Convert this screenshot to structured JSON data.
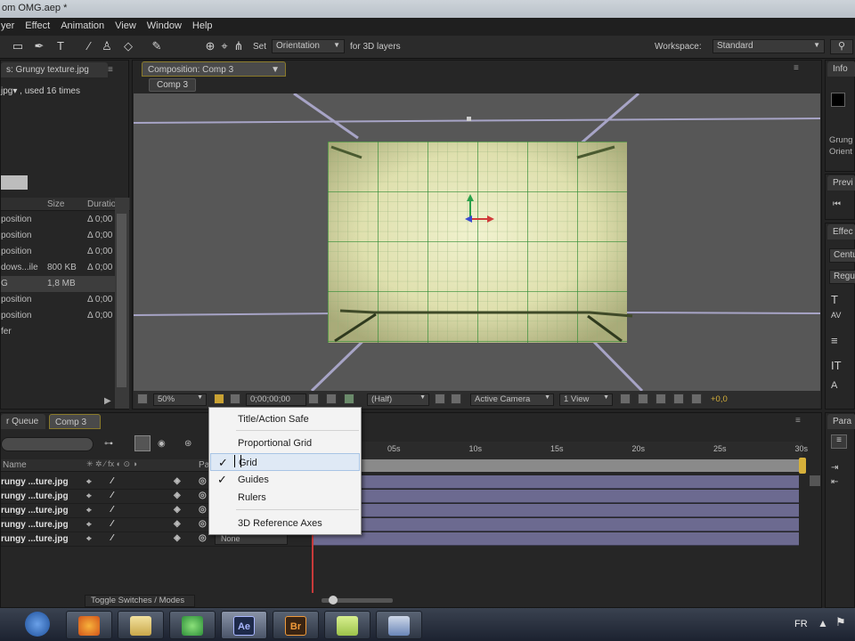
{
  "window": {
    "title": "om OMG.aep *"
  },
  "menubar": [
    "yer",
    "Effect",
    "Animation",
    "View",
    "Window",
    "Help"
  ],
  "toolbar": {
    "set_label": "Set",
    "orientation_value": "Orientation",
    "for_label": "for 3D layers",
    "workspace_label": "Workspace:",
    "workspace_value": "Standard"
  },
  "project": {
    "tab_label": "s: Grungy texture.jpg",
    "file_label": "jpg▾ , used 16 times",
    "col_size": "Size",
    "col_duration": "Duration",
    "rows": [
      {
        "name": "position",
        "size": "",
        "duration": "Δ 0;00"
      },
      {
        "name": "position",
        "size": "",
        "duration": "Δ 0;00"
      },
      {
        "name": "position",
        "size": "",
        "duration": "Δ 0;00"
      },
      {
        "name": "dows...ile",
        "size": "800 KB",
        "duration": "Δ 0;00"
      },
      {
        "name": "G",
        "size": "1,8 MB",
        "duration": ""
      },
      {
        "name": "position",
        "size": "",
        "duration": "Δ 0;00"
      },
      {
        "name": "position",
        "size": "",
        "duration": "Δ 0;00"
      },
      {
        "name": "fer",
        "size": "",
        "duration": ""
      }
    ]
  },
  "composition": {
    "tab_label": "Composition: Comp 3",
    "comp_button": "Comp 3",
    "zoom": "50%",
    "timecode": "0;00;00;00",
    "resolution": "(Half)",
    "camera": "Active Camera",
    "views": "1 View",
    "exposure": "+0,0"
  },
  "right": {
    "info_tab": "Info",
    "info_lines": [
      "Grung",
      "Orient"
    ],
    "preview_tab": "Previ",
    "effects_tab": "Effec",
    "effects_dd1": "Centu",
    "effects_dd2": "Regul",
    "para_tab": "Para"
  },
  "timeline": {
    "tab_queue": "r Queue",
    "tab_comp": "Comp 3",
    "col_name": "Name",
    "col_parent": "Pa",
    "ruler": [
      "05s",
      "10s",
      "15s",
      "20s",
      "25s",
      "30s"
    ],
    "layers": [
      "rungy ...ture.jpg",
      "rungy ...ture.jpg",
      "rungy ...ture.jpg",
      "rungy ...ture.jpg",
      "rungy ...ture.jpg"
    ],
    "parent_value": "None",
    "toggle_label": "Toggle Switches / Modes"
  },
  "menu": {
    "items": [
      {
        "label": "Title/Action Safe",
        "checked": false
      },
      {
        "label": "Proportional Grid",
        "checked": false
      },
      {
        "label": "Grid",
        "checked": true
      },
      {
        "label": "Guides",
        "checked": true
      },
      {
        "label": "Rulers",
        "checked": false
      },
      {
        "label": "3D Reference Axes",
        "checked": false
      }
    ],
    "check_glyph": "✓"
  },
  "taskbar": {
    "apps": [
      "Ae",
      "Br"
    ],
    "lang": "FR"
  },
  "colors": {
    "accent_tab": "#8a7a2a",
    "grid_line": "#3c8a3c",
    "layer_bar": "#6c6a90",
    "menu_highlight": "#dfe9f5"
  }
}
